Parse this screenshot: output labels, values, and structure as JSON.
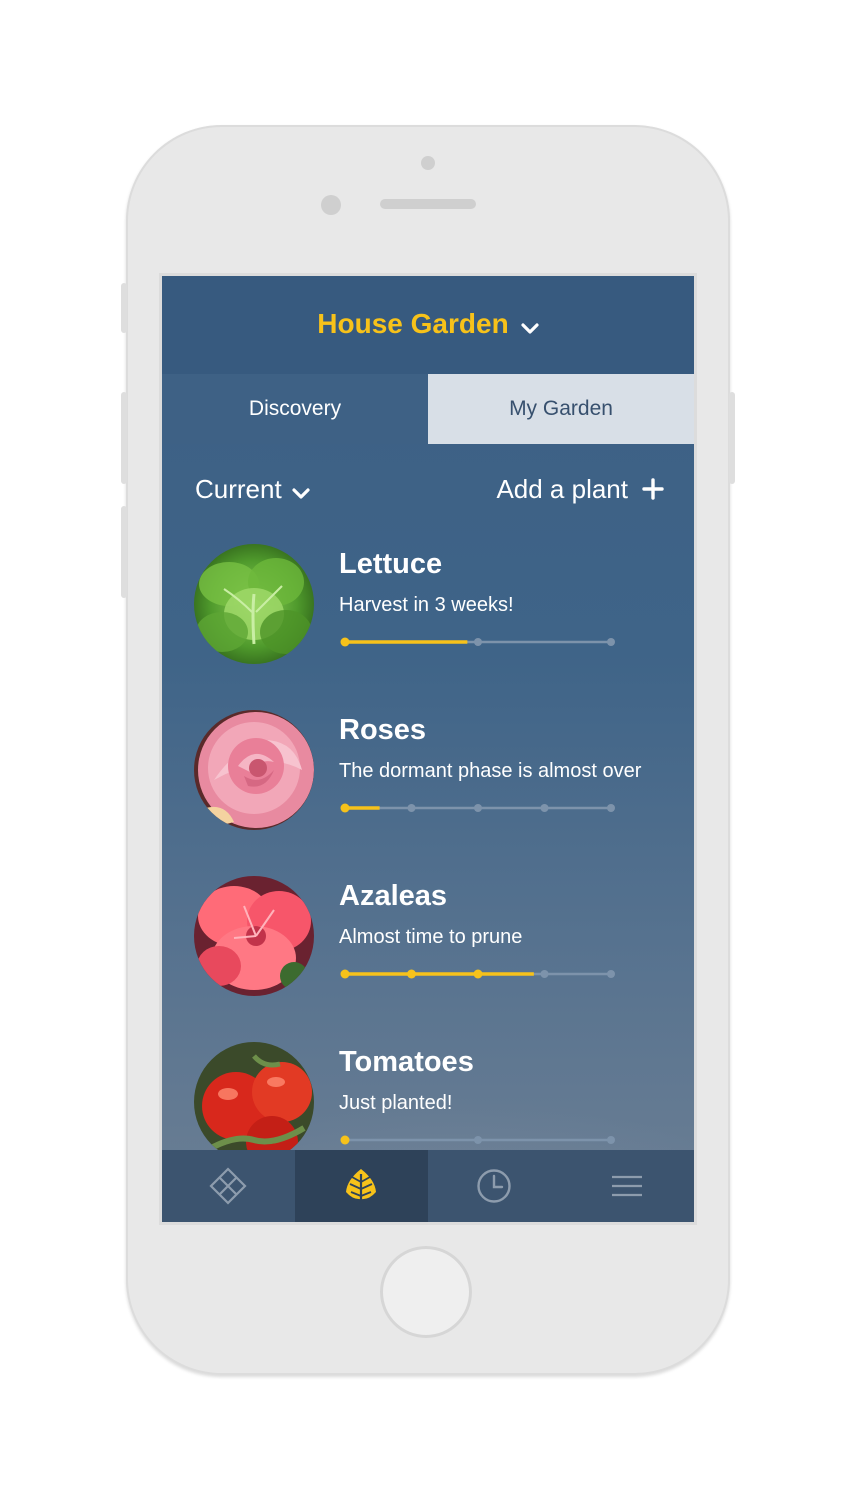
{
  "app": {
    "garden_name": "House Garden",
    "accent_color": "#f7c21a"
  },
  "tabs": [
    {
      "label": "Discovery",
      "selected": false
    },
    {
      "label": "My Garden",
      "selected": true
    }
  ],
  "toolbar": {
    "filter_label": "Current",
    "add_label": "Add a plant"
  },
  "plants": [
    {
      "name": "Lettuce",
      "status": "Harvest in 3 weeks!",
      "progress": 0.46,
      "stages": 3
    },
    {
      "name": "Roses",
      "status": "The dormant phase is almost over",
      "progress": 0.13,
      "stages": 5
    },
    {
      "name": "Azaleas",
      "status": "Almost time to prune",
      "progress": 0.71,
      "stages": 5
    },
    {
      "name": "Tomatoes",
      "status": "Just planted!",
      "progress": 0.0,
      "stages": 3
    }
  ],
  "bottom_nav": [
    {
      "icon": "diamond-grid-icon",
      "active": false
    },
    {
      "icon": "leaf-icon",
      "active": true
    },
    {
      "icon": "clock-icon",
      "active": false
    },
    {
      "icon": "hamburger-menu-icon",
      "active": false
    }
  ]
}
